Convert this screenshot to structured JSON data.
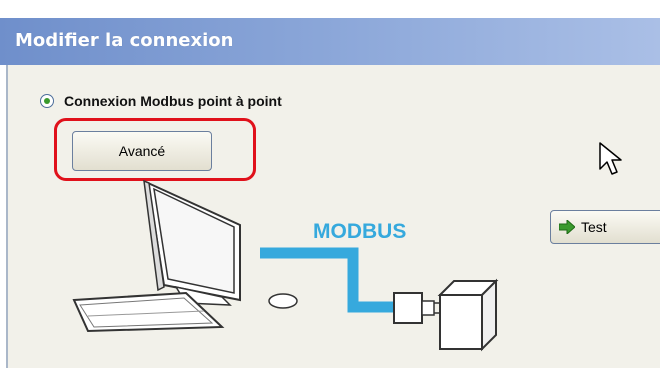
{
  "window": {
    "title": "Modifier la connexion"
  },
  "connection": {
    "option_label": "Connexion Modbus point à point",
    "option_selected": true
  },
  "buttons": {
    "advanced_label": "Avancé",
    "test_label": "Test"
  },
  "illustration": {
    "protocol_label": "MODBUS"
  },
  "colors": {
    "title_bar": "#7f9fd5",
    "panel_background": "#f2f1ea",
    "highlight": "#e0111b",
    "modbus_cable": "#36a9dd",
    "test_arrow": "#3a9a2d"
  },
  "icons": {
    "test_button_icon": "green-right-arrow-icon",
    "pointer": "mouse-cursor-icon"
  }
}
